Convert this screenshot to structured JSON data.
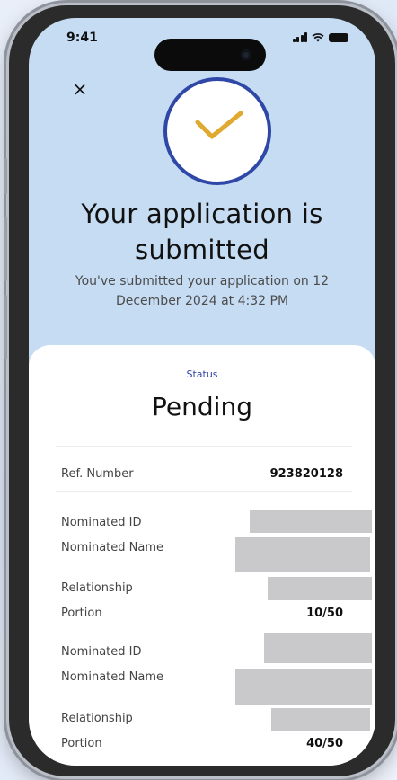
{
  "status_bar": {
    "time": "9:41"
  },
  "header": {
    "close_label": "×",
    "title": "Your application is submitted",
    "subtitle": "You've submitted your application on 12 December 2024 at 4:32 PM"
  },
  "card": {
    "status_label": "Status",
    "status_value": "Pending",
    "reference": {
      "label": "Ref. Number",
      "value": "923820128"
    },
    "nominees": [
      {
        "id_label": "Nominated ID",
        "name_label": "Nominated Name",
        "relationship_label": "Relationship",
        "portion_label": "Portion",
        "portion_value": "10/50"
      },
      {
        "id_label": "Nominated ID",
        "name_label": "Nominated Name",
        "relationship_label": "Relationship",
        "portion_label": "Portion",
        "portion_value": "40/50"
      }
    ]
  },
  "colors": {
    "accent": "#2f47a7",
    "check": "#e0a92f",
    "header_bg": "#c6dcf3",
    "redacted": "#c9c9cc"
  },
  "icons": [
    "close-icon",
    "checkmark-icon",
    "signal-icon",
    "wifi-icon",
    "battery-icon"
  ]
}
